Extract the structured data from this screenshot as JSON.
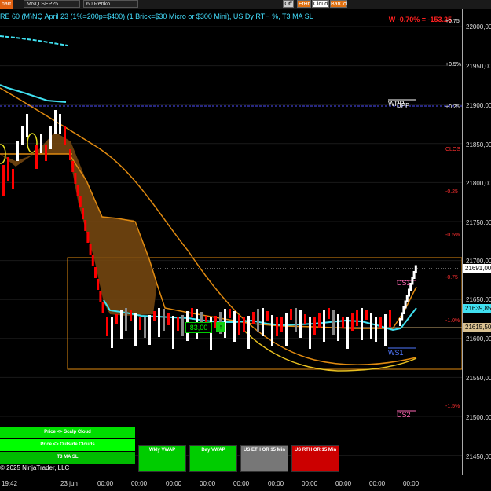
{
  "toolbar": {
    "chart_label": "hart",
    "instrument": "MNQ SEP25",
    "bar_type": "60 Renko",
    "buttons": [
      "Off",
      "EtHr",
      "Cloud",
      "BarCol"
    ],
    "button_colors": [
      "#cccccc",
      "#e07010",
      "#ffffff",
      "#e07010"
    ]
  },
  "chart_title": "RE 60 (M)NQ April 23 (1%=200p=$400) (1 Brick=$30 Micro or $300 Mini), US Dy RTH %, T3 MA SL",
  "pl_readout": "W -0.70% = -153.25",
  "price_axis": {
    "ticks": [
      "22000,00",
      "21950,00",
      "21900,00",
      "21850,00",
      "21800,00",
      "21750,00",
      "21700,00",
      "21650,00",
      "21600,00",
      "21550,00",
      "21500,00",
      "21450,00"
    ],
    "pct_labels": [
      {
        "text": "+0.75",
        "dir": "up"
      },
      {
        "text": "+0.5%",
        "dir": "up"
      },
      {
        "text": "+0.25",
        "dir": "up"
      },
      {
        "text": "CLOS",
        "dir": "down"
      },
      {
        "text": "-0.25",
        "dir": "down"
      },
      {
        "text": "-0.5%",
        "dir": "down"
      },
      {
        "text": "-0.75",
        "dir": "down"
      },
      {
        "text": "-1.0%",
        "dir": "down"
      },
      {
        "text": "-1.5%",
        "dir": "down"
      }
    ],
    "current_price": "21691,00",
    "vwap_price": "21639,85",
    "level_price": "21615,50"
  },
  "levels": {
    "ds1": "DS1",
    "ds2": "DS2",
    "ws1": "WS1",
    "wpp": "WPP",
    "dpp": "DPP"
  },
  "value_box": "83,00",
  "value_arrow": "↑",
  "time_axis": [
    "19:42",
    "23 jun",
    "00:00",
    "00:00",
    "00:00",
    "00:00",
    "00:00",
    "00:00",
    "00:00",
    "00:00",
    "00:00",
    "00:00",
    "00:01"
  ],
  "legend": {
    "rows": [
      "Price <> Scalp Cloud",
      "Price <> Outside Clouds",
      "T3 MA SL"
    ],
    "colors": [
      "#00dd00",
      "#00ff00",
      "#00bb00"
    ]
  },
  "vwap_buttons": [
    {
      "label": "Wkly VWAP",
      "color": "#00cc00"
    },
    {
      "label": "Day VWAP",
      "color": "#00cc00"
    },
    {
      "label": "US ETH OR 15 Min",
      "color": "#777777"
    },
    {
      "label": "US RTH OR 15 Min",
      "color": "#cc0000"
    }
  ],
  "copyright": "© 2025 NinjaTrader, LLC",
  "colors": {
    "up_brick": "#ffffff",
    "down_brick": "#ff0000",
    "neutral_brick": "#888888",
    "vwap_line": "#40e0f0",
    "ma_line": "#e08a10",
    "cloud_fill": "#7a4a10",
    "range_box": "#e08a10",
    "wpp_line": "#5050ff"
  }
}
